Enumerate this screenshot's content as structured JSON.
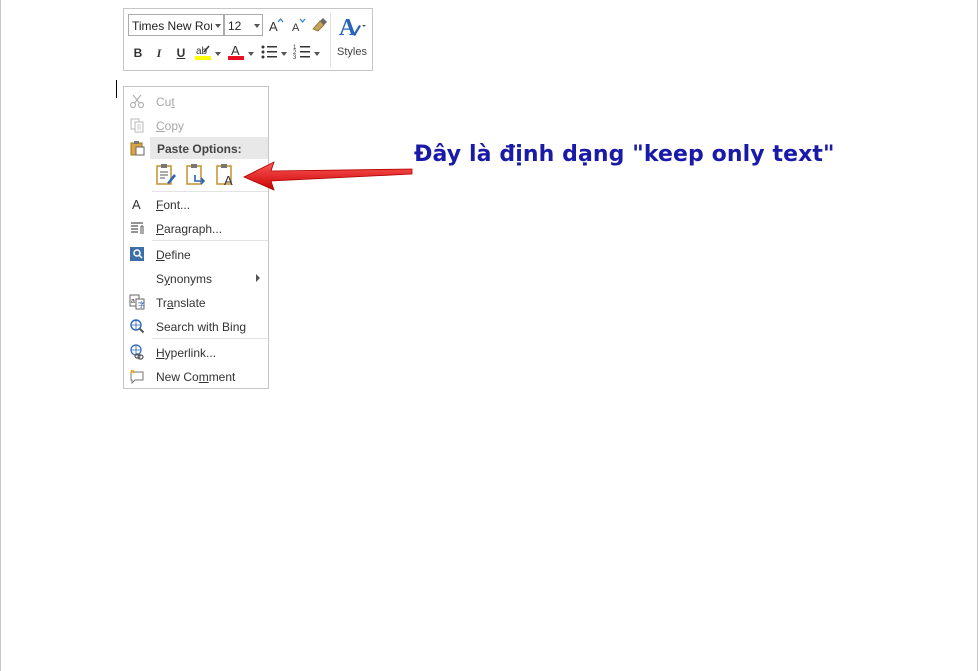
{
  "mini_toolbar": {
    "font_name": "Times New Roman",
    "font_size": "12",
    "bold": "B",
    "italic": "I",
    "underline": "U",
    "highlight_glyph": "ab",
    "font_color_glyph": "A",
    "grow_font_glyph": "A",
    "shrink_font_glyph": "A",
    "styles_label": "Styles",
    "highlight_color": "#ffff00",
    "font_color": "#e81123"
  },
  "context_menu": {
    "cut": "Cut",
    "copy": "Copy",
    "paste_options_header": "Paste Options:",
    "font": "Font...",
    "paragraph": "Paragraph...",
    "define": "Define",
    "synonyms": "Synonyms",
    "translate": "Translate",
    "search_with_bing": "Search with Bing",
    "hyperlink": "Hyperlink...",
    "new_comment": "New Comment"
  },
  "annotation": {
    "text": "Đây là định dạng \"keep only text\"",
    "color": "#1a1aa8",
    "arrow_color": "#e81123"
  }
}
